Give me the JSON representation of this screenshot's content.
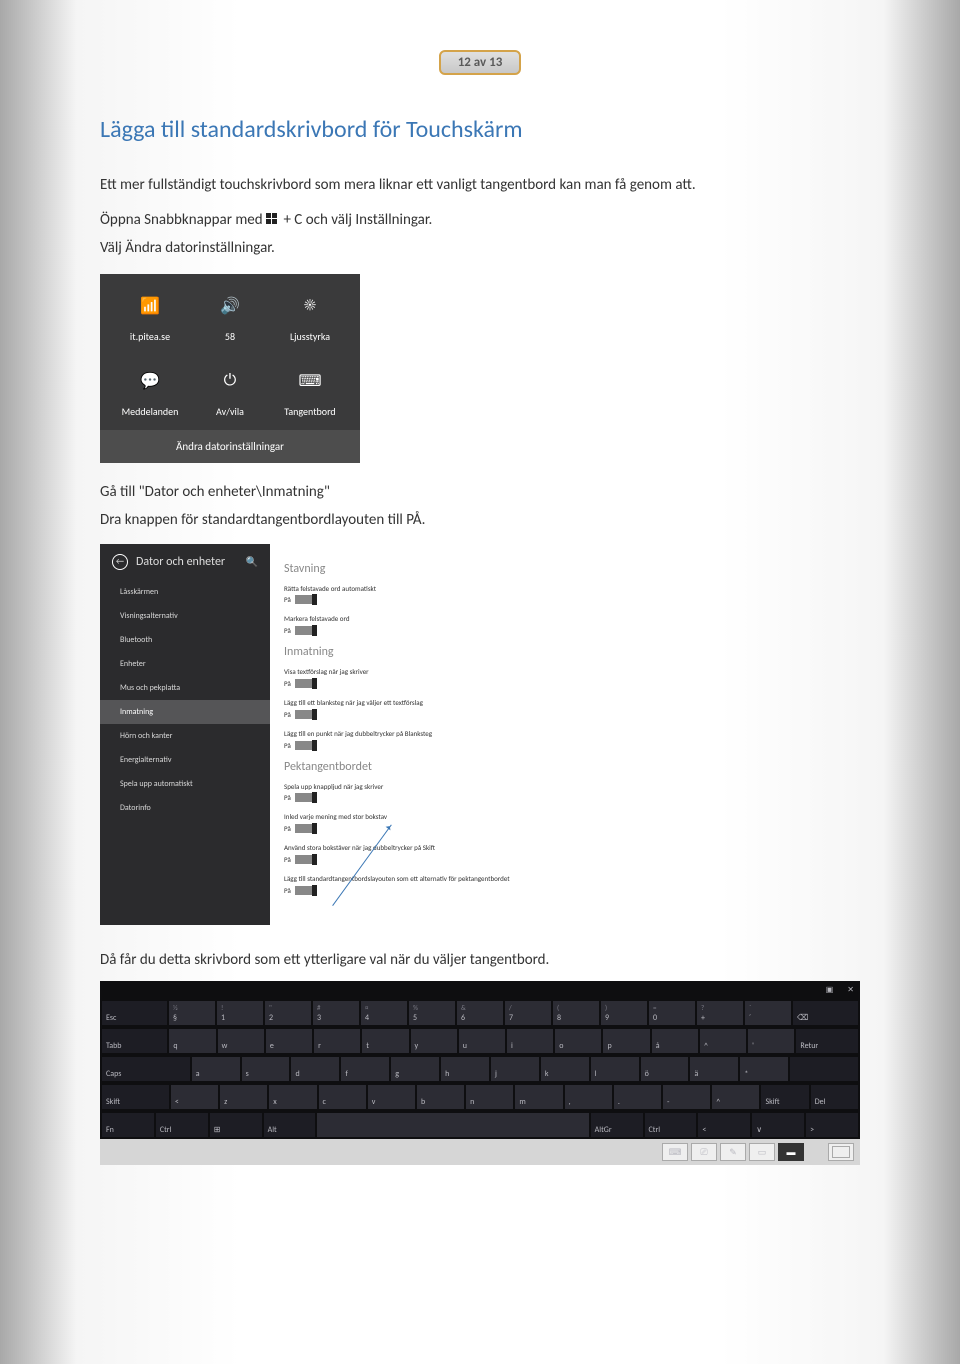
{
  "page_badge": "12 av 13",
  "heading": "Lägga till standardskrivbord för Touchskärm",
  "para1": "Ett mer fullständigt touchskrivbord som mera liknar ett vanligt tangentbord kan man få genom att.",
  "para2_a": "Öppna Snabbknappar med ",
  "para2_b": " + C och välj Inställningar.",
  "para3": "Välj Ändra datorinställningar.",
  "charms": {
    "row1": [
      {
        "label": "it.pitea.se",
        "icon": "📶"
      },
      {
        "label": "58",
        "icon": "🔊"
      },
      {
        "label": "Ljusstyrka",
        "icon": "☀"
      }
    ],
    "row2": [
      {
        "label": "Meddelanden",
        "icon": "💬"
      },
      {
        "label": "Av/vila",
        "icon": "⏻"
      },
      {
        "label": "Tangentbord",
        "icon": "⌨"
      }
    ],
    "footer": "Ändra datorinställningar"
  },
  "para4": "Gå till \"Dator och enheter\\Inmatning\"",
  "para5": "Dra knappen för standardtangentbordlayouten till PÅ.",
  "settings": {
    "header": "Dator och enheter",
    "sidebar": [
      "Låsskärmen",
      "Visningsalternativ",
      "Bluetooth",
      "Enheter",
      "Mus och pekplatta",
      "Inmatning",
      "Hörn och kanter",
      "Energialternativ",
      "Spela upp automatiskt",
      "Datorinfo"
    ],
    "selected": "Inmatning",
    "sections": [
      {
        "title": "Stavning",
        "opts": [
          {
            "label": "Rätta felstavade ord automatiskt",
            "state": "På"
          },
          {
            "label": "Markera felstavade ord",
            "state": "På"
          }
        ]
      },
      {
        "title": "Inmatning",
        "opts": [
          {
            "label": "Visa textförslag när jag skriver",
            "state": "På"
          },
          {
            "label": "Lägg till ett blanksteg när jag väljer ett textförslag",
            "state": "På"
          },
          {
            "label": "Lägg till en punkt när jag dubbeltrycker på Blanksteg",
            "state": "På"
          }
        ]
      },
      {
        "title": "Pektangentbordet",
        "opts": [
          {
            "label": "Spela upp knappljud när jag skriver",
            "state": "På"
          },
          {
            "label": "Inled varje mening med stor bokstav",
            "state": "På"
          },
          {
            "label": "Använd stora bokstäver när jag dubbeltrycker på Skift",
            "state": "På"
          },
          {
            "label": "Lägg till standardtangentbordslayouten som ett alternativ för pektangentbordet",
            "state": "På"
          }
        ]
      }
    ]
  },
  "para6": "Då får du detta skrivbord som ett ytterligare val när du väljer tangentbord.",
  "keyboard": {
    "top": {
      "back": "⌫",
      "close": "✕",
      "undock": "▣"
    },
    "numsym": [
      "½",
      "!",
      "\"",
      "#",
      "¤",
      "%",
      "&",
      "/",
      "(",
      ")",
      "=",
      "?",
      "`"
    ],
    "num": [
      "§",
      "1",
      "2",
      "3",
      "4",
      "5",
      "6",
      "7",
      "8",
      "9",
      "0",
      "+",
      "´"
    ],
    "r1_special": [
      "Esc"
    ],
    "r2_lead": "Tabb",
    "r2": [
      "q",
      "w",
      "e",
      "r",
      "t",
      "y",
      "u",
      "i",
      "o",
      "p",
      "å",
      "^",
      "'"
    ],
    "r2_tail": "Retur",
    "r3_lead": "Caps",
    "r3": [
      "a",
      "s",
      "d",
      "f",
      "g",
      "h",
      "j",
      "k",
      "l",
      "ö",
      "ä",
      "*"
    ],
    "r4_lead": "Skift",
    "r4": [
      "<",
      "z",
      "x",
      "c",
      "v",
      "b",
      "n",
      "m",
      ",",
      ".",
      "-",
      "^"
    ],
    "r4_tail": [
      "Skift",
      "Del"
    ],
    "r5": [
      "Fn",
      "Ctrl",
      "⊞",
      "Alt",
      " ",
      "AltGr",
      "Ctrl",
      "<",
      "∨",
      ">"
    ]
  }
}
